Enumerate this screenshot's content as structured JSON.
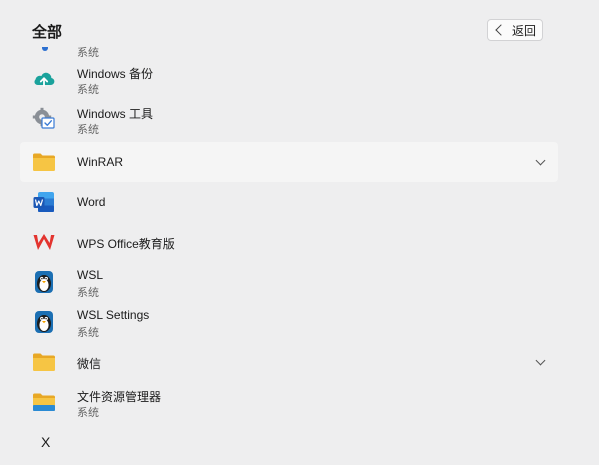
{
  "header": {
    "title": "全部",
    "back_label": "返回"
  },
  "partial_item": {
    "sub": "系统"
  },
  "items": [
    {
      "name": "Windows 备份",
      "sub": "系统",
      "icon": "cloud-backup-icon"
    },
    {
      "name": "Windows 工具",
      "sub": "系统",
      "icon": "windows-tools-icon"
    },
    {
      "name": "WinRAR",
      "icon": "folder-icon",
      "expandable": true
    },
    {
      "name": "Word",
      "icon": "word-icon"
    },
    {
      "name": "WPS Office教育版",
      "icon": "wps-icon"
    },
    {
      "name": "WSL",
      "sub": "系统",
      "icon": "penguin-icon"
    },
    {
      "name": "WSL Settings",
      "sub": "系统",
      "icon": "penguin-icon"
    },
    {
      "name": "微信",
      "icon": "folder-icon",
      "expandable": true
    },
    {
      "name": "文件资源管理器",
      "sub": "系统",
      "icon": "file-explorer-icon"
    }
  ],
  "section_letter": "X",
  "colors": {
    "accent": "#0067c0",
    "folder": "#f6c544",
    "backup": "#1aa29c",
    "wps": "#e3342f"
  }
}
